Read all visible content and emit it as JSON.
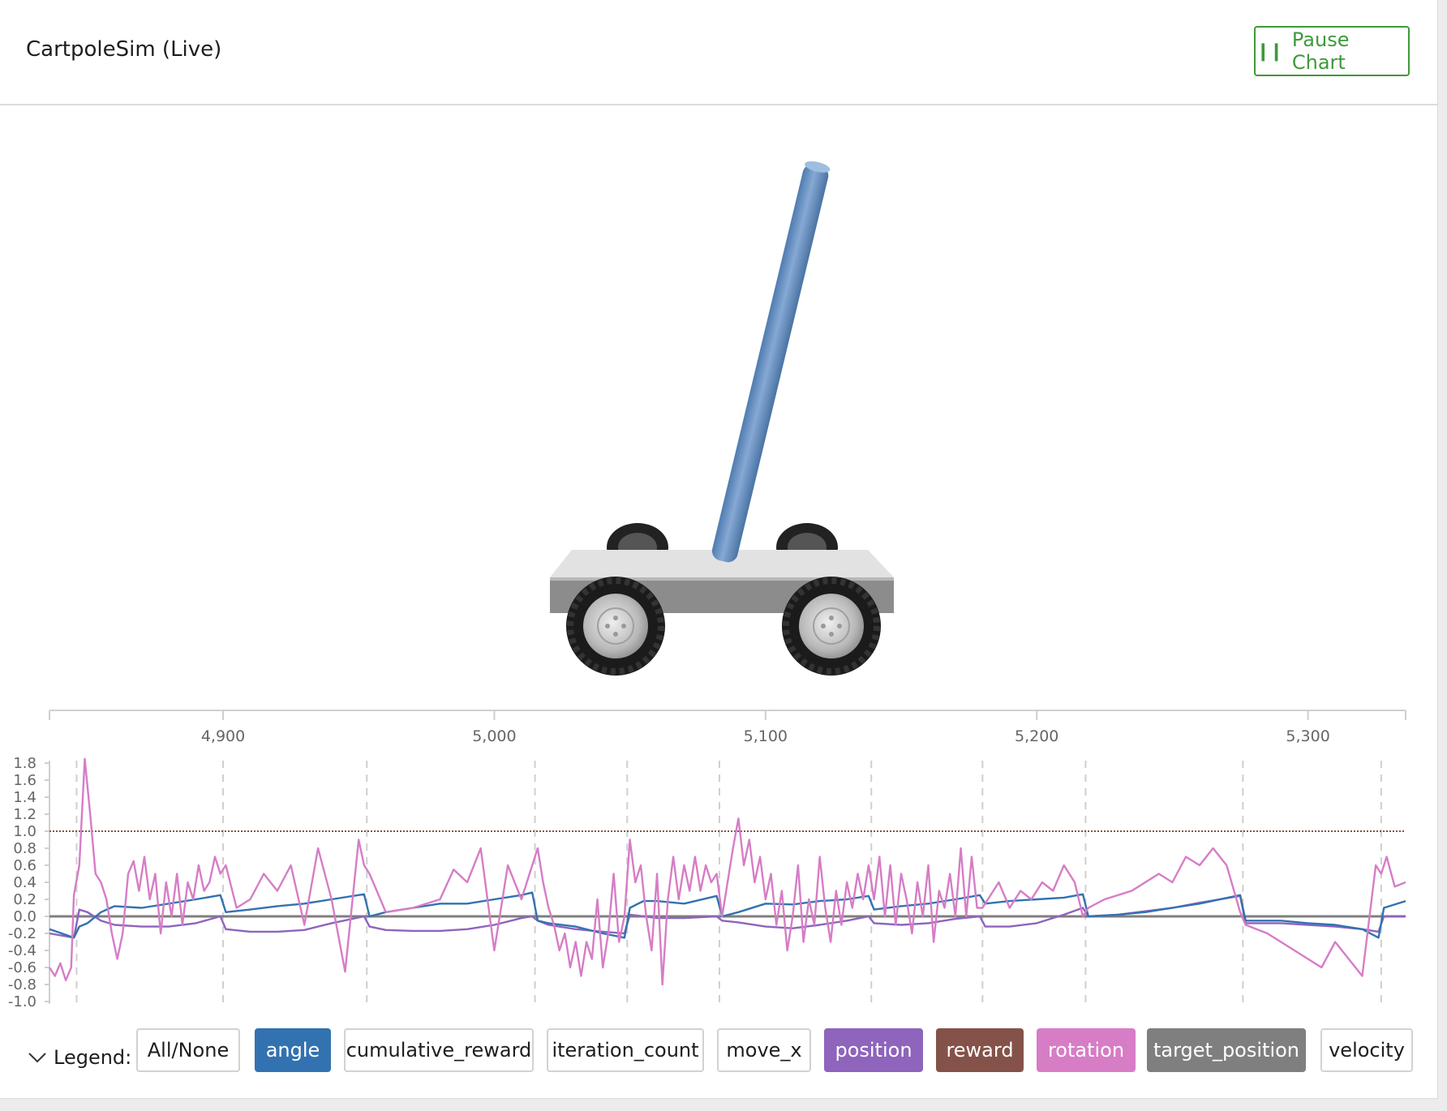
{
  "header": {
    "title": "CartpoleSim (Live)",
    "pause_label": "Pause Chart",
    "pause_icon": "pause-icon",
    "accent": "#3e9a3a"
  },
  "legend": {
    "toggle_label": "Legend:",
    "items": [
      {
        "label": "All/None",
        "active": false,
        "color": ""
      },
      {
        "label": "angle",
        "active": true,
        "color": "#3372b0"
      },
      {
        "label": "cumulative_reward",
        "active": false,
        "color": ""
      },
      {
        "label": "iteration_count",
        "active": false,
        "color": ""
      },
      {
        "label": "move_x",
        "active": false,
        "color": ""
      },
      {
        "label": "position",
        "active": true,
        "color": "#8e64bc"
      },
      {
        "label": "reward",
        "active": true,
        "color": "#845249"
      },
      {
        "label": "rotation",
        "active": true,
        "color": "#d67dc6"
      },
      {
        "label": "target_position",
        "active": true,
        "color": "#7f7f7f"
      },
      {
        "label": "velocity",
        "active": false,
        "color": ""
      }
    ]
  },
  "chart_data": {
    "type": "line",
    "x_ticks": [
      "4,900",
      "5,000",
      "5,100",
      "5,200",
      "5,300"
    ],
    "x_tick_values": [
      4900,
      5000,
      5100,
      5200,
      5300
    ],
    "xlim": [
      4836,
      5336
    ],
    "y_ticks": [
      "1.8",
      "1.6",
      "1.4",
      "1.2",
      "1.0",
      "0.8",
      "0.6",
      "0.4",
      "0.2",
      "0.0",
      "-0.2",
      "-0.4",
      "-0.6",
      "-0.8",
      "-1.0"
    ],
    "ylim": [
      -1.0,
      1.9
    ],
    "episode_boundaries": [
      4846,
      4900,
      4953,
      5015,
      5049,
      5083,
      5139,
      5180,
      5218,
      5276,
      5327
    ],
    "series": [
      {
        "name": "reward",
        "color": "#845249",
        "dashed": true,
        "x": [
          4836,
          5336
        ],
        "y": [
          1.0,
          1.0
        ]
      },
      {
        "name": "target_position",
        "color": "#7f7f7f",
        "x": [
          4836,
          5336
        ],
        "y": [
          0.0,
          0.0
        ]
      },
      {
        "name": "position",
        "color": "#8e64bc",
        "x": [
          4836,
          4845,
          4847,
          4850,
          4855,
          4860,
          4870,
          4880,
          4890,
          4899,
          4901,
          4910,
          4920,
          4930,
          4940,
          4952,
          4954,
          4960,
          4970,
          4980,
          4990,
          5000,
          5010,
          5014,
          5016,
          5020,
          5030,
          5040,
          5048,
          5050,
          5055,
          5060,
          5070,
          5082,
          5084,
          5090,
          5100,
          5110,
          5120,
          5130,
          5138,
          5140,
          5150,
          5160,
          5170,
          5179,
          5181,
          5190,
          5200,
          5210,
          5217,
          5219,
          5230,
          5240,
          5250,
          5260,
          5275,
          5277,
          5290,
          5300,
          5310,
          5320,
          5326,
          5328,
          5336
        ],
        "y": [
          -0.2,
          -0.25,
          0.08,
          0.05,
          -0.05,
          -0.1,
          -0.12,
          -0.12,
          -0.08,
          0.0,
          -0.15,
          -0.18,
          -0.18,
          -0.16,
          -0.08,
          0.0,
          -0.12,
          -0.16,
          -0.17,
          -0.17,
          -0.15,
          -0.1,
          -0.02,
          0.0,
          -0.05,
          -0.1,
          -0.15,
          -0.18,
          -0.2,
          0.02,
          0.0,
          -0.02,
          -0.02,
          0.0,
          -0.05,
          -0.07,
          -0.12,
          -0.14,
          -0.1,
          -0.05,
          0.0,
          -0.08,
          -0.1,
          -0.08,
          -0.03,
          0.0,
          -0.12,
          -0.12,
          -0.08,
          0.02,
          0.1,
          0.0,
          0.02,
          0.06,
          0.1,
          0.16,
          0.24,
          -0.08,
          -0.08,
          -0.1,
          -0.12,
          -0.15,
          -0.18,
          0.0,
          0.0
        ]
      },
      {
        "name": "angle",
        "color": "#3372b0",
        "x": [
          4836,
          4845,
          4847,
          4850,
          4855,
          4860,
          4870,
          4880,
          4890,
          4899,
          4901,
          4910,
          4920,
          4930,
          4940,
          4952,
          4954,
          4960,
          4970,
          4980,
          4990,
          5000,
          5010,
          5014,
          5016,
          5020,
          5030,
          5040,
          5048,
          5050,
          5055,
          5060,
          5070,
          5082,
          5084,
          5090,
          5100,
          5110,
          5120,
          5130,
          5138,
          5140,
          5150,
          5160,
          5170,
          5179,
          5181,
          5190,
          5200,
          5210,
          5217,
          5219,
          5230,
          5240,
          5250,
          5260,
          5275,
          5277,
          5290,
          5300,
          5310,
          5320,
          5326,
          5328,
          5336
        ],
        "y": [
          -0.15,
          -0.25,
          -0.12,
          -0.08,
          0.05,
          0.12,
          0.1,
          0.15,
          0.2,
          0.25,
          0.05,
          0.08,
          0.12,
          0.15,
          0.2,
          0.26,
          0.0,
          0.05,
          0.1,
          0.15,
          0.15,
          0.2,
          0.25,
          0.28,
          -0.05,
          -0.08,
          -0.12,
          -0.2,
          -0.25,
          0.1,
          0.18,
          0.18,
          0.15,
          0.24,
          0.0,
          0.05,
          0.15,
          0.14,
          0.18,
          0.2,
          0.24,
          0.08,
          0.12,
          0.15,
          0.2,
          0.25,
          0.15,
          0.18,
          0.2,
          0.22,
          0.26,
          0.0,
          0.02,
          0.05,
          0.1,
          0.15,
          0.25,
          -0.05,
          -0.05,
          -0.08,
          -0.1,
          -0.15,
          -0.25,
          0.1,
          0.18
        ]
      },
      {
        "name": "rotation",
        "color": "#d67dc6",
        "x": [
          4836,
          4838,
          4840,
          4842,
          4844,
          4845,
          4847,
          4849,
          4851,
          4853,
          4855,
          4857,
          4859,
          4861,
          4863,
          4865,
          4867,
          4869,
          4871,
          4873,
          4875,
          4877,
          4879,
          4881,
          4883,
          4885,
          4887,
          4889,
          4891,
          4893,
          4895,
          4897,
          4899,
          4901,
          4905,
          4910,
          4915,
          4920,
          4925,
          4930,
          4935,
          4940,
          4945,
          4950,
          4952,
          4954,
          4960,
          4970,
          4980,
          4985,
          4990,
          4995,
          5000,
          5005,
          5010,
          5014,
          5016,
          5018,
          5020,
          5022,
          5024,
          5026,
          5028,
          5030,
          5032,
          5034,
          5036,
          5038,
          5040,
          5042,
          5044,
          5046,
          5048,
          5050,
          5052,
          5054,
          5056,
          5058,
          5060,
          5062,
          5064,
          5066,
          5068,
          5070,
          5072,
          5074,
          5076,
          5078,
          5080,
          5082,
          5084,
          5086,
          5088,
          5090,
          5092,
          5094,
          5096,
          5098,
          5100,
          5102,
          5104,
          5106,
          5108,
          5110,
          5112,
          5114,
          5116,
          5118,
          5120,
          5122,
          5124,
          5126,
          5128,
          5130,
          5132,
          5134,
          5136,
          5138,
          5140,
          5142,
          5144,
          5146,
          5148,
          5150,
          5152,
          5154,
          5156,
          5158,
          5160,
          5162,
          5164,
          5166,
          5168,
          5170,
          5172,
          5174,
          5176,
          5178,
          5180,
          5182,
          5186,
          5190,
          5194,
          5198,
          5202,
          5206,
          5210,
          5214,
          5217,
          5219,
          5225,
          5235,
          5245,
          5250,
          5255,
          5260,
          5265,
          5270,
          5275,
          5277,
          5285,
          5295,
          5305,
          5310,
          5315,
          5320,
          5325,
          5327,
          5329,
          5332,
          5336
        ],
        "y": [
          -0.6,
          -0.7,
          -0.55,
          -0.75,
          -0.6,
          0.25,
          0.6,
          1.85,
          1.2,
          0.5,
          0.4,
          0.2,
          -0.2,
          -0.5,
          -0.2,
          0.5,
          0.65,
          0.3,
          0.7,
          0.2,
          0.5,
          -0.2,
          0.4,
          0.0,
          0.5,
          -0.1,
          0.4,
          0.2,
          0.6,
          0.3,
          0.4,
          0.7,
          0.5,
          0.6,
          0.1,
          0.2,
          0.5,
          0.3,
          0.6,
          -0.1,
          0.8,
          0.2,
          -0.65,
          0.9,
          0.6,
          0.5,
          0.05,
          0.1,
          0.2,
          0.55,
          0.4,
          0.8,
          -0.4,
          0.6,
          0.2,
          0.6,
          0.8,
          0.4,
          0.1,
          -0.1,
          -0.4,
          -0.2,
          -0.6,
          -0.3,
          -0.7,
          -0.3,
          -0.5,
          0.2,
          -0.6,
          -0.2,
          0.5,
          -0.3,
          0.0,
          0.9,
          0.4,
          0.6,
          0.0,
          -0.4,
          0.5,
          -0.8,
          0.2,
          0.7,
          0.2,
          0.6,
          0.3,
          0.7,
          0.3,
          0.6,
          0.4,
          0.5,
          0.0,
          0.4,
          0.8,
          1.15,
          0.6,
          0.9,
          0.4,
          0.7,
          0.2,
          0.5,
          -0.1,
          0.3,
          -0.4,
          0.0,
          0.6,
          -0.3,
          0.2,
          -0.1,
          0.7,
          0.1,
          -0.3,
          0.3,
          -0.1,
          0.4,
          0.1,
          0.5,
          0.2,
          0.6,
          0.2,
          0.7,
          0.0,
          0.6,
          -0.1,
          0.5,
          0.2,
          -0.2,
          0.4,
          0.0,
          0.6,
          -0.3,
          0.3,
          0.1,
          0.5,
          0.0,
          0.8,
          0.0,
          0.7,
          0.1,
          0.1,
          0.2,
          0.4,
          0.1,
          0.3,
          0.2,
          0.4,
          0.3,
          0.6,
          0.4,
          0.0,
          0.1,
          0.2,
          0.3,
          0.5,
          0.4,
          0.7,
          0.6,
          0.8,
          0.6,
          0.05,
          -0.1,
          -0.2,
          -0.4,
          -0.6,
          -0.3,
          -0.5,
          -0.7,
          0.6,
          0.5,
          0.7,
          0.35,
          0.4
        ]
      }
    ]
  }
}
